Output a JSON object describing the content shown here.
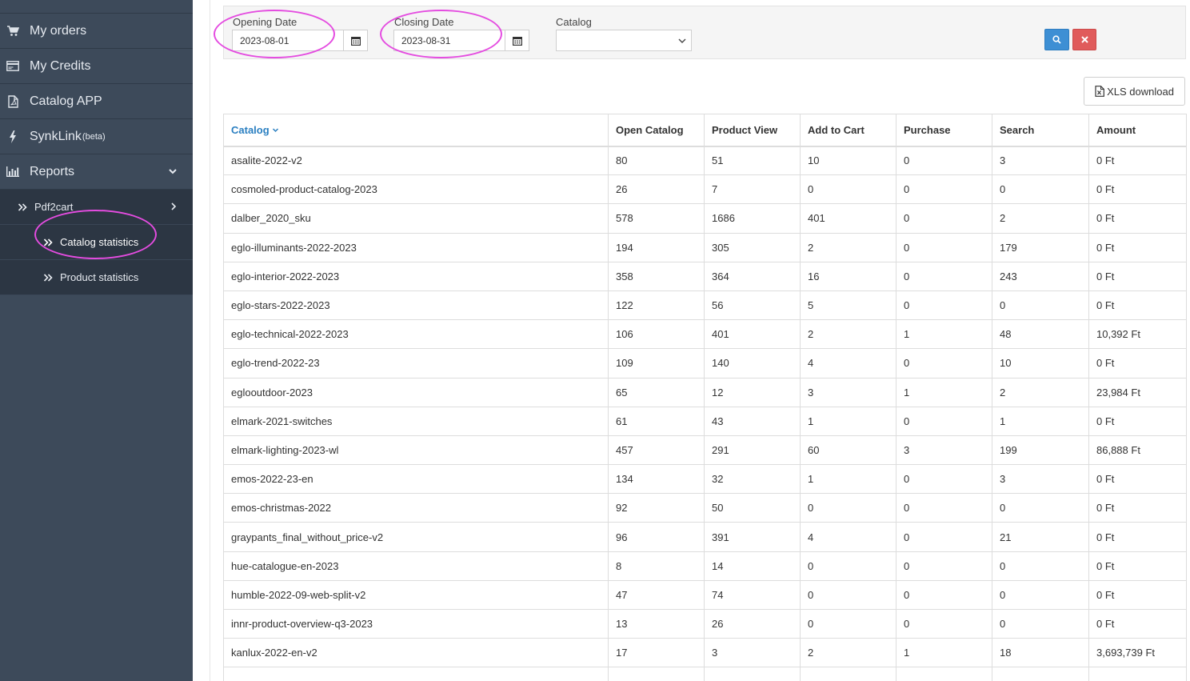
{
  "sidebar": {
    "items": [
      {
        "label": "My orders",
        "icon": "cart-icon"
      },
      {
        "label": "My Credits",
        "icon": "credit-card-icon"
      },
      {
        "label": "Catalog APP",
        "icon": "file-pdf-icon"
      },
      {
        "label": "SynkLink",
        "sup": "(beta)",
        "icon": "bolt-icon"
      },
      {
        "label": "Reports",
        "icon": "bar-chart-icon"
      }
    ],
    "sub": {
      "pdf2cart": "Pdf2cart",
      "catalog_statistics": "Catalog statistics",
      "product_statistics": "Product statistics"
    }
  },
  "filter": {
    "opening_date_label": "Opening Date",
    "opening_date_value": "2023-08-01",
    "closing_date_label": "Closing Date",
    "closing_date_value": "2023-08-31",
    "catalog_label": "Catalog",
    "catalog_value": ""
  },
  "toolbar": {
    "xls_label": "XLS download"
  },
  "table": {
    "headers": [
      "Catalog",
      "Open Catalog",
      "Product View",
      "Add to Cart",
      "Purchase",
      "Search",
      "Amount"
    ],
    "rows": [
      [
        "asalite-2022-v2",
        "80",
        "51",
        "10",
        "0",
        "3",
        "0 Ft"
      ],
      [
        "cosmoled-product-catalog-2023",
        "26",
        "7",
        "0",
        "0",
        "0",
        "0 Ft"
      ],
      [
        "dalber_2020_sku",
        "578",
        "1686",
        "401",
        "0",
        "2",
        "0 Ft"
      ],
      [
        "eglo-illuminants-2022-2023",
        "194",
        "305",
        "2",
        "0",
        "179",
        "0 Ft"
      ],
      [
        "eglo-interior-2022-2023",
        "358",
        "364",
        "16",
        "0",
        "243",
        "0 Ft"
      ],
      [
        "eglo-stars-2022-2023",
        "122",
        "56",
        "5",
        "0",
        "0",
        "0 Ft"
      ],
      [
        "eglo-technical-2022-2023",
        "106",
        "401",
        "2",
        "1",
        "48",
        "10,392 Ft"
      ],
      [
        "eglo-trend-2022-23",
        "109",
        "140",
        "4",
        "0",
        "10",
        "0 Ft"
      ],
      [
        "eglooutdoor-2023",
        "65",
        "12",
        "3",
        "1",
        "2",
        "23,984 Ft"
      ],
      [
        "elmark-2021-switches",
        "61",
        "43",
        "1",
        "0",
        "1",
        "0 Ft"
      ],
      [
        "elmark-lighting-2023-wl",
        "457",
        "291",
        "60",
        "3",
        "199",
        "86,888 Ft"
      ],
      [
        "emos-2022-23-en",
        "134",
        "32",
        "1",
        "0",
        "3",
        "0 Ft"
      ],
      [
        "emos-christmas-2022",
        "92",
        "50",
        "0",
        "0",
        "0",
        "0 Ft"
      ],
      [
        "graypants_final_without_price-v2",
        "96",
        "391",
        "4",
        "0",
        "21",
        "0 Ft"
      ],
      [
        "hue-catalogue-en-2023",
        "8",
        "14",
        "0",
        "0",
        "0",
        "0 Ft"
      ],
      [
        "humble-2022-09-web-split-v2",
        "47",
        "74",
        "0",
        "0",
        "0",
        "0 Ft"
      ],
      [
        "innr-product-overview-q3-2023",
        "13",
        "26",
        "0",
        "0",
        "0",
        "0 Ft"
      ],
      [
        "kanlux-2022-en-v2",
        "17",
        "3",
        "2",
        "1",
        "18",
        "3,693,739 Ft"
      ]
    ]
  }
}
